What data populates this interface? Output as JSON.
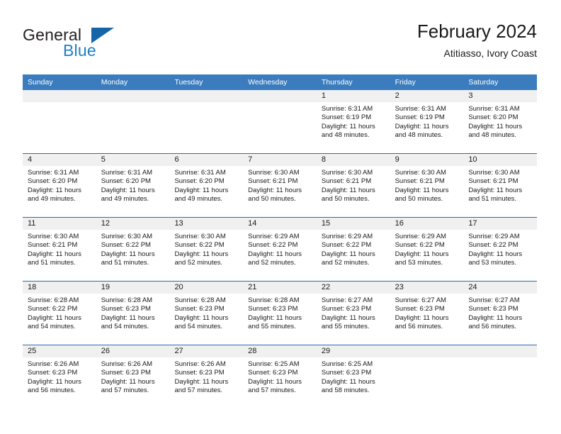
{
  "brand": {
    "name_part1": "General",
    "name_part2": "Blue",
    "logo_icon": "triangle-logo-icon"
  },
  "header": {
    "month_year": "February 2024",
    "location": "Atitiasso, Ivory Coast"
  },
  "colors": {
    "header_blue": "#3a7cbe",
    "row_divider_blue": "#2a6aad",
    "daynum_band": "#f0f0f0",
    "brand_blue": "#1f7fc4",
    "text": "#1a1a1a"
  },
  "calendar": {
    "weekday_headers": [
      "Sunday",
      "Monday",
      "Tuesday",
      "Wednesday",
      "Thursday",
      "Friday",
      "Saturday"
    ],
    "labels": {
      "sunrise_prefix": "Sunrise:",
      "sunset_prefix": "Sunset:",
      "daylight_prefix": "Daylight:"
    },
    "weeks": [
      [
        {
          "day": "",
          "empty": true
        },
        {
          "day": "",
          "empty": true
        },
        {
          "day": "",
          "empty": true
        },
        {
          "day": "",
          "empty": true
        },
        {
          "day": "1",
          "sunrise": "Sunrise: 6:31 AM",
          "sunset": "Sunset: 6:19 PM",
          "daylight_line1": "Daylight: 11 hours",
          "daylight_line2": "and 48 minutes."
        },
        {
          "day": "2",
          "sunrise": "Sunrise: 6:31 AM",
          "sunset": "Sunset: 6:19 PM",
          "daylight_line1": "Daylight: 11 hours",
          "daylight_line2": "and 48 minutes."
        },
        {
          "day": "3",
          "sunrise": "Sunrise: 6:31 AM",
          "sunset": "Sunset: 6:20 PM",
          "daylight_line1": "Daylight: 11 hours",
          "daylight_line2": "and 48 minutes."
        }
      ],
      [
        {
          "day": "4",
          "sunrise": "Sunrise: 6:31 AM",
          "sunset": "Sunset: 6:20 PM",
          "daylight_line1": "Daylight: 11 hours",
          "daylight_line2": "and 49 minutes."
        },
        {
          "day": "5",
          "sunrise": "Sunrise: 6:31 AM",
          "sunset": "Sunset: 6:20 PM",
          "daylight_line1": "Daylight: 11 hours",
          "daylight_line2": "and 49 minutes."
        },
        {
          "day": "6",
          "sunrise": "Sunrise: 6:31 AM",
          "sunset": "Sunset: 6:20 PM",
          "daylight_line1": "Daylight: 11 hours",
          "daylight_line2": "and 49 minutes."
        },
        {
          "day": "7",
          "sunrise": "Sunrise: 6:30 AM",
          "sunset": "Sunset: 6:21 PM",
          "daylight_line1": "Daylight: 11 hours",
          "daylight_line2": "and 50 minutes."
        },
        {
          "day": "8",
          "sunrise": "Sunrise: 6:30 AM",
          "sunset": "Sunset: 6:21 PM",
          "daylight_line1": "Daylight: 11 hours",
          "daylight_line2": "and 50 minutes."
        },
        {
          "day": "9",
          "sunrise": "Sunrise: 6:30 AM",
          "sunset": "Sunset: 6:21 PM",
          "daylight_line1": "Daylight: 11 hours",
          "daylight_line2": "and 50 minutes."
        },
        {
          "day": "10",
          "sunrise": "Sunrise: 6:30 AM",
          "sunset": "Sunset: 6:21 PM",
          "daylight_line1": "Daylight: 11 hours",
          "daylight_line2": "and 51 minutes."
        }
      ],
      [
        {
          "day": "11",
          "sunrise": "Sunrise: 6:30 AM",
          "sunset": "Sunset: 6:21 PM",
          "daylight_line1": "Daylight: 11 hours",
          "daylight_line2": "and 51 minutes."
        },
        {
          "day": "12",
          "sunrise": "Sunrise: 6:30 AM",
          "sunset": "Sunset: 6:22 PM",
          "daylight_line1": "Daylight: 11 hours",
          "daylight_line2": "and 51 minutes."
        },
        {
          "day": "13",
          "sunrise": "Sunrise: 6:30 AM",
          "sunset": "Sunset: 6:22 PM",
          "daylight_line1": "Daylight: 11 hours",
          "daylight_line2": "and 52 minutes."
        },
        {
          "day": "14",
          "sunrise": "Sunrise: 6:29 AM",
          "sunset": "Sunset: 6:22 PM",
          "daylight_line1": "Daylight: 11 hours",
          "daylight_line2": "and 52 minutes."
        },
        {
          "day": "15",
          "sunrise": "Sunrise: 6:29 AM",
          "sunset": "Sunset: 6:22 PM",
          "daylight_line1": "Daylight: 11 hours",
          "daylight_line2": "and 52 minutes."
        },
        {
          "day": "16",
          "sunrise": "Sunrise: 6:29 AM",
          "sunset": "Sunset: 6:22 PM",
          "daylight_line1": "Daylight: 11 hours",
          "daylight_line2": "and 53 minutes."
        },
        {
          "day": "17",
          "sunrise": "Sunrise: 6:29 AM",
          "sunset": "Sunset: 6:22 PM",
          "daylight_line1": "Daylight: 11 hours",
          "daylight_line2": "and 53 minutes."
        }
      ],
      [
        {
          "day": "18",
          "sunrise": "Sunrise: 6:28 AM",
          "sunset": "Sunset: 6:22 PM",
          "daylight_line1": "Daylight: 11 hours",
          "daylight_line2": "and 54 minutes."
        },
        {
          "day": "19",
          "sunrise": "Sunrise: 6:28 AM",
          "sunset": "Sunset: 6:23 PM",
          "daylight_line1": "Daylight: 11 hours",
          "daylight_line2": "and 54 minutes."
        },
        {
          "day": "20",
          "sunrise": "Sunrise: 6:28 AM",
          "sunset": "Sunset: 6:23 PM",
          "daylight_line1": "Daylight: 11 hours",
          "daylight_line2": "and 54 minutes."
        },
        {
          "day": "21",
          "sunrise": "Sunrise: 6:28 AM",
          "sunset": "Sunset: 6:23 PM",
          "daylight_line1": "Daylight: 11 hours",
          "daylight_line2": "and 55 minutes."
        },
        {
          "day": "22",
          "sunrise": "Sunrise: 6:27 AM",
          "sunset": "Sunset: 6:23 PM",
          "daylight_line1": "Daylight: 11 hours",
          "daylight_line2": "and 55 minutes."
        },
        {
          "day": "23",
          "sunrise": "Sunrise: 6:27 AM",
          "sunset": "Sunset: 6:23 PM",
          "daylight_line1": "Daylight: 11 hours",
          "daylight_line2": "and 56 minutes."
        },
        {
          "day": "24",
          "sunrise": "Sunrise: 6:27 AM",
          "sunset": "Sunset: 6:23 PM",
          "daylight_line1": "Daylight: 11 hours",
          "daylight_line2": "and 56 minutes."
        }
      ],
      [
        {
          "day": "25",
          "sunrise": "Sunrise: 6:26 AM",
          "sunset": "Sunset: 6:23 PM",
          "daylight_line1": "Daylight: 11 hours",
          "daylight_line2": "and 56 minutes."
        },
        {
          "day": "26",
          "sunrise": "Sunrise: 6:26 AM",
          "sunset": "Sunset: 6:23 PM",
          "daylight_line1": "Daylight: 11 hours",
          "daylight_line2": "and 57 minutes."
        },
        {
          "day": "27",
          "sunrise": "Sunrise: 6:26 AM",
          "sunset": "Sunset: 6:23 PM",
          "daylight_line1": "Daylight: 11 hours",
          "daylight_line2": "and 57 minutes."
        },
        {
          "day": "28",
          "sunrise": "Sunrise: 6:25 AM",
          "sunset": "Sunset: 6:23 PM",
          "daylight_line1": "Daylight: 11 hours",
          "daylight_line2": "and 57 minutes."
        },
        {
          "day": "29",
          "sunrise": "Sunrise: 6:25 AM",
          "sunset": "Sunset: 6:23 PM",
          "daylight_line1": "Daylight: 11 hours",
          "daylight_line2": "and 58 minutes."
        },
        {
          "day": "",
          "empty": true
        },
        {
          "day": "",
          "empty": true
        }
      ]
    ]
  }
}
